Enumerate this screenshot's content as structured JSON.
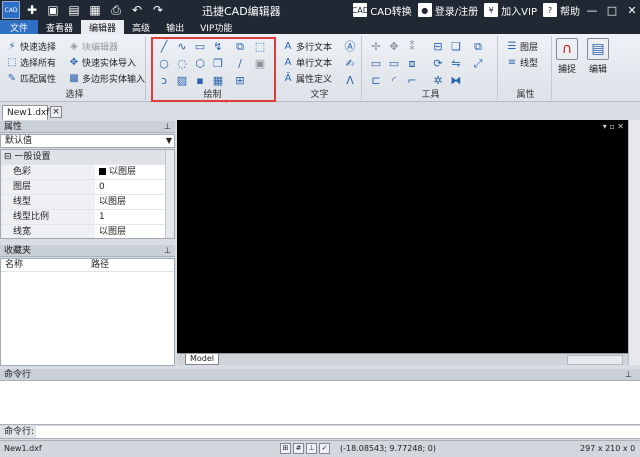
{
  "titlebar": {
    "logo": "CAD",
    "title": "迅捷CAD编辑器",
    "cad_convert": "CAD转换",
    "login": "登录/注册",
    "vip": "加入VIP",
    "help": "帮助",
    "help_icon": "?",
    "vip_icon": "¥",
    "cad_icon": "CAD"
  },
  "menu": {
    "file": "文件",
    "tabs": [
      "查看器",
      "编辑器",
      "高级",
      "输出",
      "VIP功能"
    ]
  },
  "ribbon": {
    "select_group": {
      "label": "选择",
      "items": [
        "快速选择",
        "选择所有",
        "匹配属性",
        "块编辑器",
        "快速实体导入",
        "多边形实体输入"
      ]
    },
    "draw_group": {
      "label": "绘制"
    },
    "text_group": {
      "label": "文字",
      "items": [
        "多行文本",
        "单行文本",
        "属性定义"
      ]
    },
    "tools_group": {
      "label": "工具"
    },
    "props_group": {
      "label": "属性",
      "items": [
        "图层",
        "线型"
      ]
    },
    "snap_button": "捕捉",
    "edit_button": "编辑"
  },
  "document": {
    "tab": "New1.dxf",
    "close": "×"
  },
  "properties_panel": {
    "title": "属性",
    "selector": "默认值",
    "section": "一般设置",
    "rows": [
      {
        "key": "色彩",
        "value": "以图层"
      },
      {
        "key": "图层",
        "value": "0"
      },
      {
        "key": "线型",
        "value": "以图层"
      },
      {
        "key": "线型比例",
        "value": "1"
      },
      {
        "key": "线宽",
        "value": "以图层"
      }
    ]
  },
  "favorites_panel": {
    "title": "收藏夹",
    "col_name": "名称",
    "col_path": "路径"
  },
  "canvas": {
    "model_tab": "Model"
  },
  "command": {
    "title": "命令行",
    "input_label": "命令行:",
    "input_value": ""
  },
  "status": {
    "file": "New1.dxf",
    "coords": "(-18.08543; 9.77248; 0)",
    "size": "297 x 210 x 0"
  }
}
